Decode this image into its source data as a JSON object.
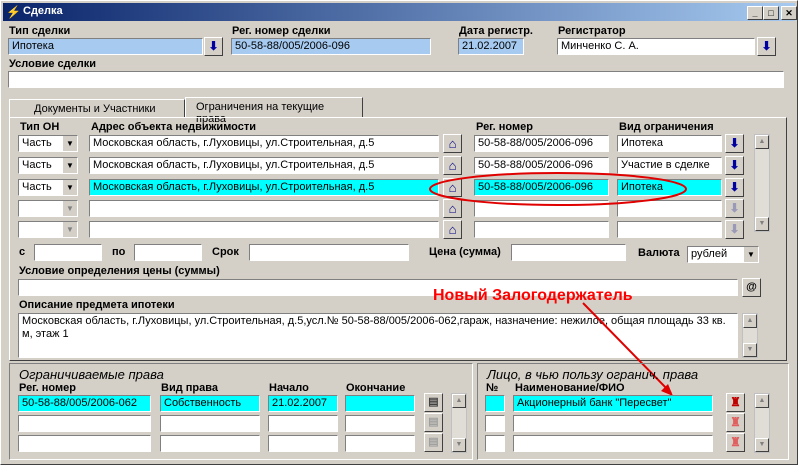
{
  "window": {
    "title": "Сделка"
  },
  "header": {
    "deal_type_label": "Тип сделки",
    "deal_type_value": "Ипотека",
    "reg_number_label": "Рег. номер сделки",
    "reg_number_value": "50-58-88/005/2006-096",
    "reg_date_label": "Дата регистр.",
    "reg_date_value": "21.02.2007",
    "registrar_label": "Регистратор",
    "registrar_value": "Минченко С. А.",
    "condition_label": "Условие сделки",
    "condition_value": ""
  },
  "tabs": [
    {
      "label": "Документы и Участники"
    },
    {
      "label": "Ограничения на текущие права"
    }
  ],
  "restrictions": {
    "col_type": "Тип ОН",
    "col_address": "Адрес объекта недвижимости",
    "col_regnum": "Рег. номер",
    "col_kind": "Вид ограничения",
    "rows": [
      {
        "type": "Часть",
        "address": "Московская область, г.Луховицы, ул.Строительная, д.5",
        "regnum": "50-58-88/005/2006-096",
        "kind": "Ипотека"
      },
      {
        "type": "Часть",
        "address": "Московская область, г.Луховицы, ул.Строительная, д.5",
        "regnum": "50-58-88/005/2006-096",
        "kind": "Участие в сделке"
      },
      {
        "type": "Часть",
        "address": "Московская область, г.Луховицы, ул.Строительная, д.5",
        "regnum": "50-58-88/005/2006-096",
        "kind": "Ипотека"
      },
      {
        "type": "",
        "address": "",
        "regnum": "",
        "kind": ""
      },
      {
        "type": "",
        "address": "",
        "regnum": "",
        "kind": ""
      }
    ]
  },
  "terms": {
    "from_label": "с",
    "to_label": "по",
    "term_label": "Срок",
    "price_label": "Цена (сумма)",
    "currency_label": "Валюта",
    "currency_value": "рублей",
    "price_condition_label": "Условие определения цены (суммы)",
    "price_condition_value": "",
    "at_button": "@",
    "subject_label": "Описание предмета ипотеки",
    "subject_value": "Московская область, г.Луховицы, ул.Строительная, д.5,усл.№ 50-58-88/005/2006-062,гараж, назначение: нежилое, общая площадь 33 кв. м, этаж 1"
  },
  "annotation": {
    "text": "Новый Залогодержатель",
    "color": "#ff0000"
  },
  "limited_rights": {
    "title": "Ограничиваемые права",
    "col_regnum": "Рег. номер",
    "col_kind": "Вид права",
    "col_start": "Начало",
    "col_end": "Окончание",
    "rows": [
      {
        "regnum": "50-58-88/005/2006-062",
        "kind": "Собственность",
        "start": "21.02.2007",
        "end": ""
      },
      {
        "regnum": "",
        "kind": "",
        "start": "",
        "end": ""
      },
      {
        "regnum": "",
        "kind": "",
        "start": "",
        "end": ""
      }
    ]
  },
  "beneficiary": {
    "title": "Лицо, в чью пользу огранич. права",
    "col_num": "№",
    "col_name": "Наименование/ФИО",
    "rows": [
      {
        "num": "",
        "name": "Акционерный банк \"Пересвет\""
      },
      {
        "num": "",
        "name": ""
      },
      {
        "num": "",
        "name": ""
      }
    ]
  },
  "colors": {
    "selected_row": "#00ffff",
    "readonly_field": "#a6caf0",
    "title_start": "#0a246a",
    "title_end": "#a6caf0"
  }
}
